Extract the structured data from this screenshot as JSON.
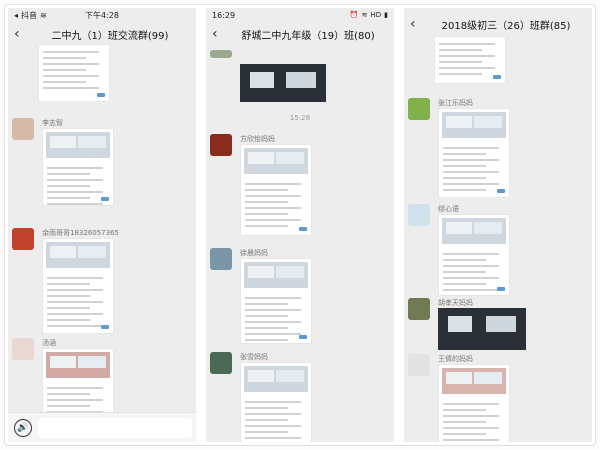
{
  "panels": [
    {
      "status": {
        "left": "抖音",
        "time": "下午4:28"
      },
      "title": "二中九（1）班交流群(99)",
      "senders": [
        "李志智",
        "余雨哥哥18326057365",
        "汤涵"
      ],
      "input": {
        "voice_glyph": "🔊"
      }
    },
    {
      "status": {
        "time": "16:29",
        "right": "HD"
      },
      "title": "舒城二中九年级（19）班(80)",
      "time_divider": "15:28",
      "senders": [
        "方欣怡妈妈",
        "徐晨妈妈",
        "张雪妈妈"
      ]
    },
    {
      "title": "2018级初三（26）班群(85)",
      "senders": [
        "张江乐妈妈",
        "缪心语",
        "胡孝天妈妈",
        "王倩的妈妈"
      ]
    }
  ],
  "icons": {
    "back": "‹"
  }
}
